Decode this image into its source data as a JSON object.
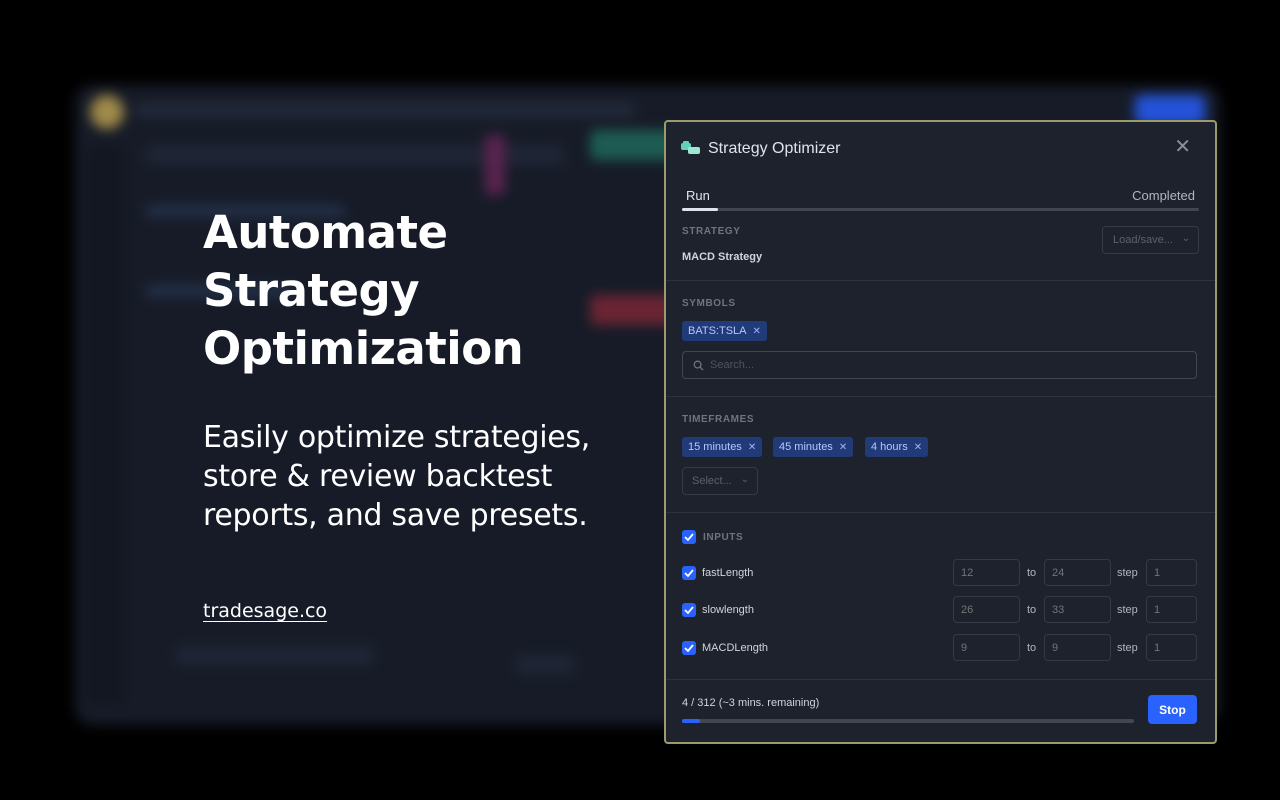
{
  "hero": {
    "title": "Automate Strategy Optimization",
    "subtitle": "Easily optimize strategies, store & review backtest reports, and save presets.",
    "link": "tradesage.co"
  },
  "dialog": {
    "title": "Strategy Optimizer",
    "close_icon": "close-icon",
    "tabs": {
      "run": "Run",
      "completed": "Completed",
      "progress": 0.07
    },
    "strategy": {
      "label": "STRATEGY",
      "name": "MACD Strategy",
      "load_save": "Load/save..."
    },
    "symbols": {
      "label": "SYMBOLS",
      "chips": [
        "BATS:TSLA"
      ],
      "search_placeholder": "Search..."
    },
    "timeframes": {
      "label": "TIMEFRAMES",
      "chips": [
        "15 minutes",
        "45 minutes",
        "4 hours"
      ],
      "select_placeholder": "Select..."
    },
    "inputs": {
      "label": "INPUTS",
      "to_label": "to",
      "step_label": "step",
      "rows": [
        {
          "name": "fastLength",
          "from": "12",
          "to": "24",
          "step": "1"
        },
        {
          "name": "slowlength",
          "from": "26",
          "to": "33",
          "step": "1"
        },
        {
          "name": "MACDLength",
          "from": "9",
          "to": "9",
          "step": "1"
        }
      ]
    },
    "progress": {
      "text": "4 / 312 (~3 mins. remaining)",
      "done": 4,
      "total": 312
    },
    "stop_label": "Stop"
  },
  "colors": {
    "accent": "#2962ff",
    "panel": "#1e222d",
    "chip": "#213a78"
  }
}
